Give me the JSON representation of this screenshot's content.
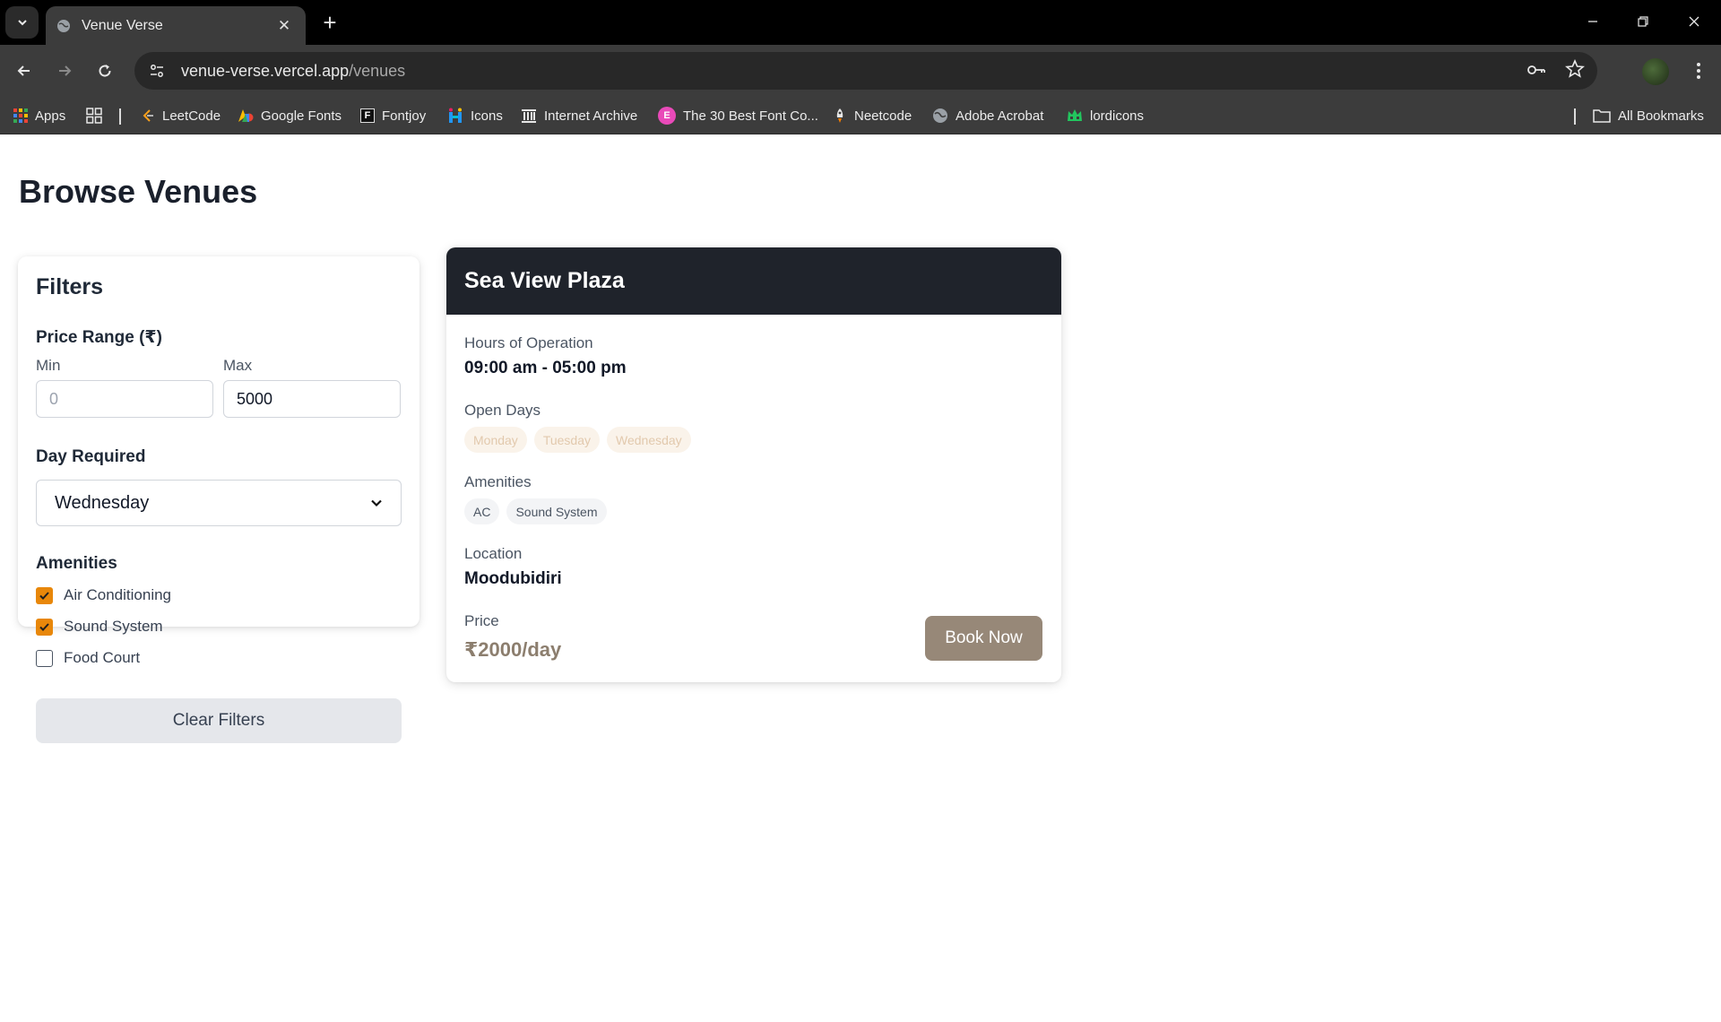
{
  "browser": {
    "tab_title": "Venue Verse",
    "url_host": "venue-verse.vercel.app",
    "url_path": "/venues",
    "bookmarks": [
      {
        "label": "Apps",
        "icon": "apps-grid-icon"
      },
      {
        "label": "LeetCode",
        "icon": "leetcode-icon"
      },
      {
        "label": "Google Fonts",
        "icon": "google-fonts-icon"
      },
      {
        "label": "Fontjoy",
        "icon": "fontjoy-icon"
      },
      {
        "label": "Icons",
        "icon": "icons8-icon"
      },
      {
        "label": "Internet Archive",
        "icon": "internet-archive-icon"
      },
      {
        "label": "The 30 Best Font Co...",
        "icon": "elementor-icon"
      },
      {
        "label": "Neetcode",
        "icon": "rocket-icon"
      },
      {
        "label": "Adobe Acrobat",
        "icon": "globe-icon"
      },
      {
        "label": "lordicons",
        "icon": "lordicon-icon"
      }
    ],
    "all_bookmarks": "All Bookmarks"
  },
  "page": {
    "title": "Browse Venues"
  },
  "filters": {
    "title": "Filters",
    "price_range_label": "Price Range (₹)",
    "min_label": "Min",
    "min_placeholder": "0",
    "min_value": "",
    "max_label": "Max",
    "max_value": "5000",
    "day_label": "Day Required",
    "day_selected": "Wednesday",
    "amenities_label": "Amenities",
    "amenities": [
      {
        "label": "Air Conditioning",
        "checked": true
      },
      {
        "label": "Sound System",
        "checked": true
      },
      {
        "label": "Food Court",
        "checked": false
      }
    ],
    "clear_label": "Clear Filters"
  },
  "venue": {
    "name": "Sea View Plaza",
    "hours_label": "Hours of Operation",
    "hours_value": "09:00 am - 05:00 pm",
    "days_label": "Open Days",
    "days": [
      "Monday",
      "Tuesday",
      "Wednesday"
    ],
    "amenities_label": "Amenities",
    "amenities": [
      "AC",
      "Sound System"
    ],
    "location_label": "Location",
    "location_value": "Moodubidiri",
    "price_label": "Price",
    "price_value": "₹2000/day",
    "book_label": "Book Now"
  },
  "colors": {
    "checkbox_accent": "#e8870a",
    "card_header": "#1f232b",
    "book_button": "#978878",
    "price_text": "#8c7e6e"
  }
}
